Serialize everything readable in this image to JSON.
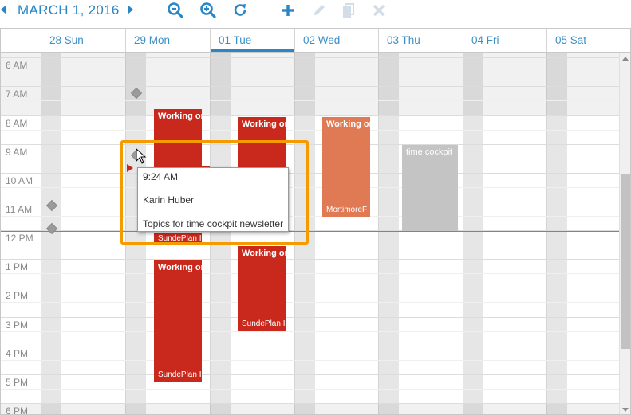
{
  "toolbar": {
    "date_label": "MARCH 1, 2016",
    "icons": [
      "chevron-left-icon",
      "chevron-right-icon",
      "zoom-out-icon",
      "zoom-in-icon",
      "refresh-icon",
      "plus-icon",
      "pencil-icon",
      "copy-icon",
      "close-icon"
    ],
    "accent_color": "#2a86c6"
  },
  "days": [
    "28 Sun",
    "29 Mon",
    "01 Tue",
    "02 Wed",
    "03 Thu",
    "04 Fri",
    "05 Sat"
  ],
  "today": "01 Tue",
  "hours": [
    "6 AM",
    "7 AM",
    "8 AM",
    "9 AM",
    "10 AM",
    "11 AM",
    "12 PM",
    "1 PM",
    "2 PM",
    "3 PM",
    "4 PM",
    "5 PM",
    "6 PM"
  ],
  "events": [
    {
      "day": "29 Mon",
      "title": "Working on",
      "footer": "",
      "color": "#c9281c"
    },
    {
      "day": "29 Mon",
      "title": "",
      "footer": "SundePlan I",
      "color": "#c9281c"
    },
    {
      "day": "29 Mon",
      "title": "Working on",
      "footer": "SundePlan I",
      "color": "#c9281c"
    },
    {
      "day": "01 Tue",
      "title": "Working on",
      "footer": "",
      "color": "#c9281c"
    },
    {
      "day": "01 Tue",
      "title": "Working on",
      "footer": "SundePlan I",
      "color": "#c9281c"
    },
    {
      "day": "02 Wed",
      "title": "Working on",
      "footer": "MortimoreF",
      "color": "#e07a54"
    },
    {
      "day": "03 Thu",
      "title": "time cockpit",
      "footer": "",
      "color": "#c4c4c4"
    }
  ],
  "tooltip": {
    "time": "9:24 AM",
    "person": "Karin Huber",
    "description": "Topics for time cockpit newsletter"
  },
  "highlight_color": "#f59a00",
  "now_line_color": "#3a9ad9"
}
